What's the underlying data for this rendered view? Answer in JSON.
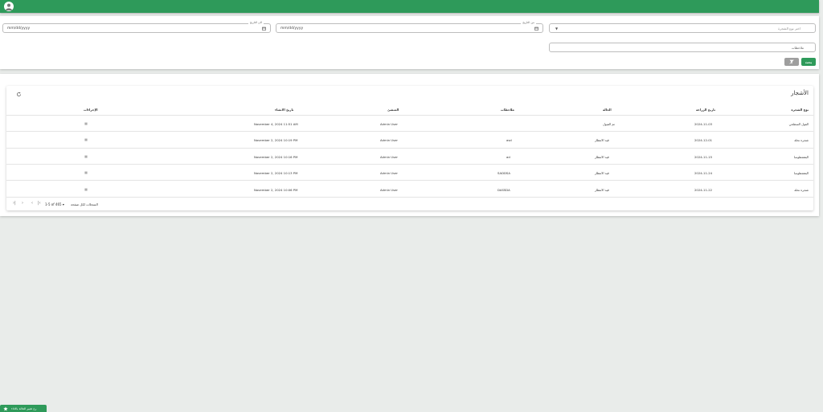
{
  "colors": {
    "primary": "#2e9a5a",
    "clear_button": "#9e9e9e"
  },
  "header": {
    "avatar_icon": "user-icon"
  },
  "filters": {
    "tree_type_placeholder": "اختر نوع الشجرة",
    "date_from_label": "من التاريخ",
    "date_from_value": "mm/dd/yyyy",
    "date_to_label": "الى التاريخ",
    "date_to_value": "mm/dd/yyyy",
    "notes_placeholder": "ملاحظات",
    "search_label": "بحث",
    "clear_icon": "filter-clear-icon"
  },
  "table": {
    "title": "الأشجار",
    "refresh_icon": "refresh-icon",
    "columns": {
      "tree_type": "نوع الشجرة",
      "planting_date": "تاريخ الزراعة",
      "status": "الحالة",
      "notes": "ملاحظات",
      "requester": "المنشئ",
      "created_at": "تاريخ الانشاء",
      "actions": "الإجراءات"
    },
    "rows": [
      {
        "tree_type": "الفول السطحي",
        "planting_date": "2024-11-03",
        "status": "تم القبول",
        "notes": "",
        "requester": "Admin User",
        "created_at": "November 4, 2024 11:51 AM"
      },
      {
        "tree_type": "شجرة نخلة",
        "planting_date": "2024-12-01",
        "status": "قيد الانتظار",
        "notes": "asd",
        "requester": "Admin User",
        "created_at": "November 2, 2024 10:19 PM"
      },
      {
        "tree_type": "البقشطوسا",
        "planting_date": "2024-11-15",
        "status": "قيد الانتظار",
        "notes": "ad",
        "requester": "Admin User",
        "created_at": "November 2, 2024 10:16 PM"
      },
      {
        "tree_type": "البقشطوسا",
        "planting_date": "2024-11-24",
        "status": "قيد الانتظار",
        "notes": "SADDSA",
        "requester": "Admin User",
        "created_at": "November 2, 2024 10:13 PM"
      },
      {
        "tree_type": "شجرة نخلة",
        "planting_date": "2024-11-22",
        "status": "قيد الانتظار",
        "notes": "DASSDA",
        "requester": "Admin User",
        "created_at": "November 2, 2024 10:06 PM"
      }
    ],
    "pagination": {
      "rows_per_page_label": "السجلات لكل صفحة",
      "rows_per_page_value": "5",
      "range_label": "1-5 of 46"
    }
  },
  "floating_button": {
    "label": "رح تغيير الحالة بالاداء",
    "icon": "star-icon"
  }
}
